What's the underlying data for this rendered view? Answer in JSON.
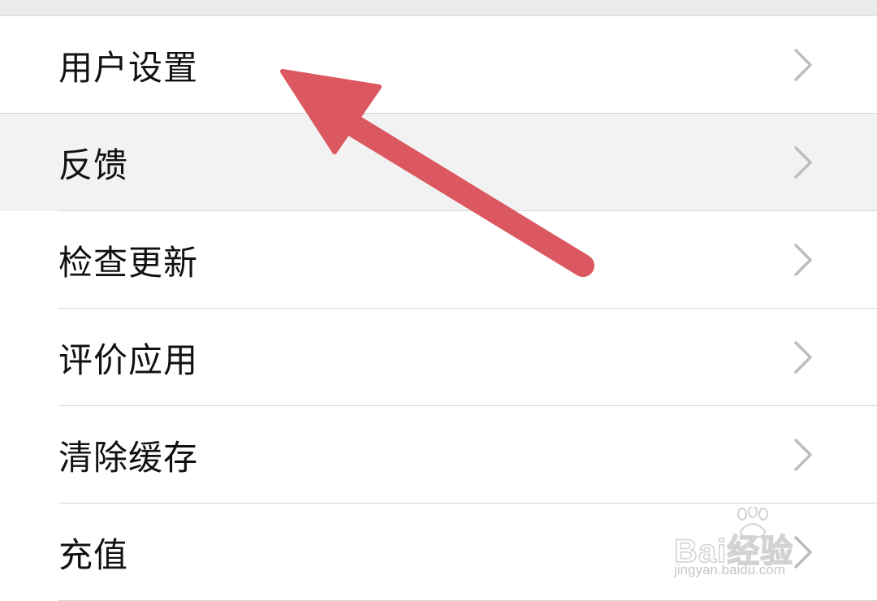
{
  "menu": {
    "items": [
      {
        "label": "用户设置",
        "icon": "chevron-right-icon",
        "highlighted": false
      },
      {
        "label": "反馈",
        "icon": "chevron-right-icon",
        "highlighted": true
      },
      {
        "label": "检查更新",
        "icon": "chevron-right-icon",
        "highlighted": false
      },
      {
        "label": "评价应用",
        "icon": "chevron-right-icon",
        "highlighted": false
      },
      {
        "label": "清除缓存",
        "icon": "chevron-right-icon",
        "highlighted": false
      },
      {
        "label": "充值",
        "icon": "chevron-right-icon",
        "highlighted": false
      }
    ]
  },
  "annotation": {
    "icon": "arrow-icon",
    "color": "#dc5860"
  },
  "watermark": {
    "brand": "Bai经验",
    "url": "jingyan.baidu.com",
    "icon": "paw-icon"
  },
  "colors": {
    "highlight_row": "#f2f2f2",
    "chevron": "#bdbdbd",
    "divider": "#d6d6d6"
  }
}
